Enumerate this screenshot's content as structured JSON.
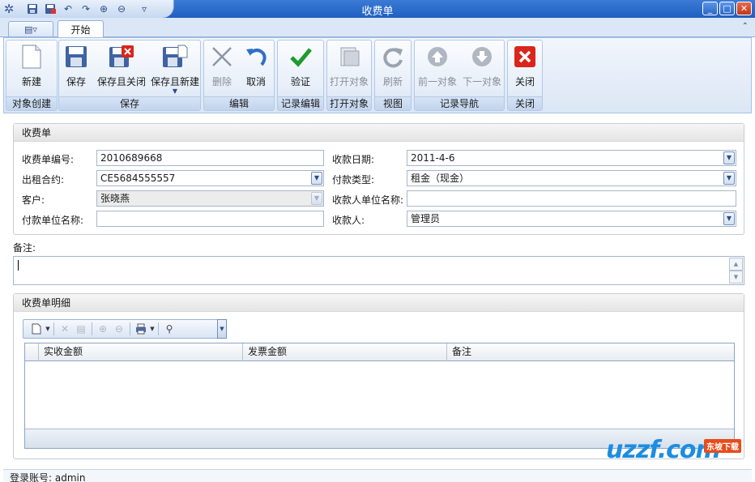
{
  "window": {
    "title": "收费单"
  },
  "tabs": {
    "menu": "▤▿",
    "start": "开始"
  },
  "ribbon": {
    "groups": {
      "create": "对象创建",
      "save": "保存",
      "edit": "编辑",
      "validate": "记录编辑",
      "open": "打开对象",
      "view": "视图",
      "nav": "记录导航",
      "close": "关闭"
    },
    "buttons": {
      "new": "新建",
      "save": "保存",
      "save_close": "保存且关闭",
      "save_new": "保存且新建",
      "delete": "删除",
      "cancel": "取消",
      "validate": "验证",
      "open_object": "打开对象",
      "refresh": "刷新",
      "prev": "前一对象",
      "next": "下一对象",
      "close": "关闭"
    }
  },
  "form": {
    "section_title": "收费单",
    "receipt_no_label": "收费单编号:",
    "receipt_no": "2010689668",
    "date_label": "收款日期:",
    "date": "2011-4-6",
    "contract_label": "出租合约:",
    "contract": "CE5684555557",
    "pay_type_label": "付款类型:",
    "pay_type": "租金（现金）",
    "customer_label": "客户:",
    "customer": "张晓燕",
    "payee_org_label": "收款人单位名称:",
    "payee_org": "",
    "payer_org_label": "付款单位名称:",
    "payer_org": "",
    "payee_label": "收款人:",
    "payee": "管理员",
    "remark_label": "备注:",
    "remark": ""
  },
  "details": {
    "section_title": "收费单明细",
    "columns": [
      "实收金额",
      "发票金额",
      "备注"
    ]
  },
  "status": {
    "login": "登录账号: admin"
  },
  "watermark": {
    "logo": "uzzf.com",
    "badge": "东坡下载"
  }
}
